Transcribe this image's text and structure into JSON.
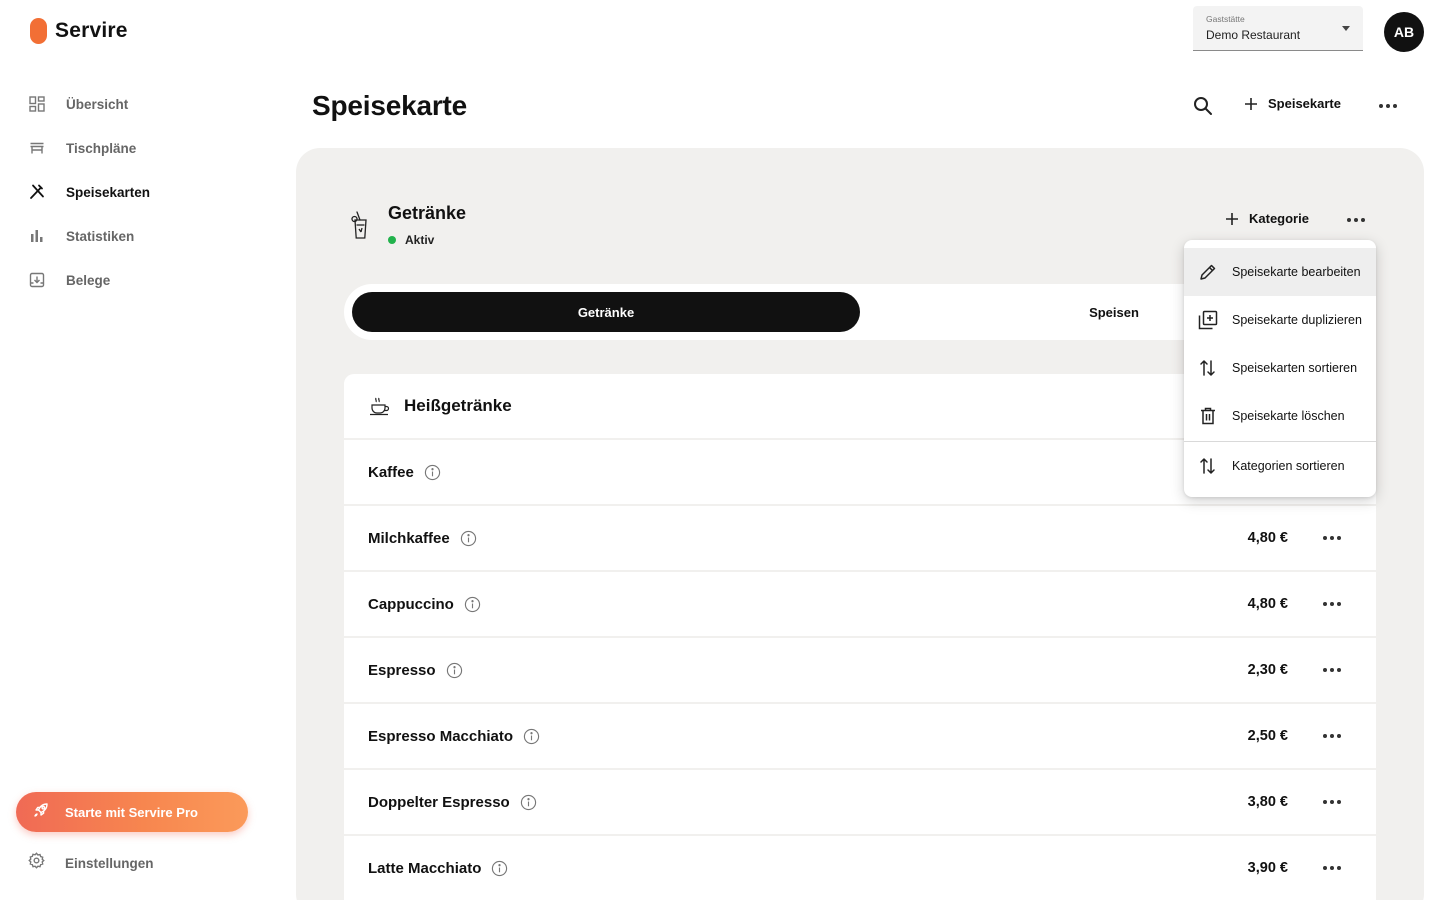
{
  "brand": {
    "name": "Servire",
    "accent": "#f26f35"
  },
  "sidebar": {
    "items": [
      {
        "label": "Übersicht",
        "icon": "dashboard-grid-icon"
      },
      {
        "label": "Tischpläne",
        "icon": "table-icon"
      },
      {
        "label": "Speisekarten",
        "icon": "cutlery-icon",
        "active": true
      },
      {
        "label": "Statistiken",
        "icon": "bar-chart-icon"
      },
      {
        "label": "Belege",
        "icon": "receipt-box-icon"
      }
    ],
    "pro_label": "Starte mit Servire Pro",
    "settings_label": "Einstellungen"
  },
  "header": {
    "venue_caption": "Gaststätte",
    "venue_value": "Demo Restaurant",
    "avatar_initials": "AB",
    "page_title": "Speisekarte",
    "add_menu_label": "Speisekarte"
  },
  "menu": {
    "name": "Getränke",
    "status": "Aktiv",
    "status_color": "#22b24c",
    "add_category_label": "Kategorie",
    "tabs": [
      {
        "label": "Getränke",
        "active": true
      },
      {
        "label": "Speisen",
        "active": false
      }
    ],
    "category": {
      "name": "Heißgetränke",
      "icon": "coffee-cup-icon"
    },
    "items": [
      {
        "name": "Kaffee",
        "price": ""
      },
      {
        "name": "Milchkaffee",
        "price": "4,80 €"
      },
      {
        "name": "Cappuccino",
        "price": "4,80 €"
      },
      {
        "name": "Espresso",
        "price": "2,30 €"
      },
      {
        "name": "Espresso Macchiato",
        "price": "2,50 €"
      },
      {
        "name": "Doppelter Espresso",
        "price": "3,80 €"
      },
      {
        "name": "Latte Macchiato",
        "price": "3,90 €"
      }
    ]
  },
  "dropdown": {
    "items": [
      {
        "label": "Speisekarte bearbeiten",
        "icon": "pencil-icon"
      },
      {
        "label": "Speisekarte duplizieren",
        "icon": "duplicate-icon"
      },
      {
        "label": "Speisekarten sortieren",
        "icon": "sort-arrows-icon"
      },
      {
        "label": "Speisekarte löschen",
        "icon": "trash-icon"
      },
      {
        "label": "Kategorien sortieren",
        "icon": "sort-arrows-icon"
      }
    ]
  }
}
